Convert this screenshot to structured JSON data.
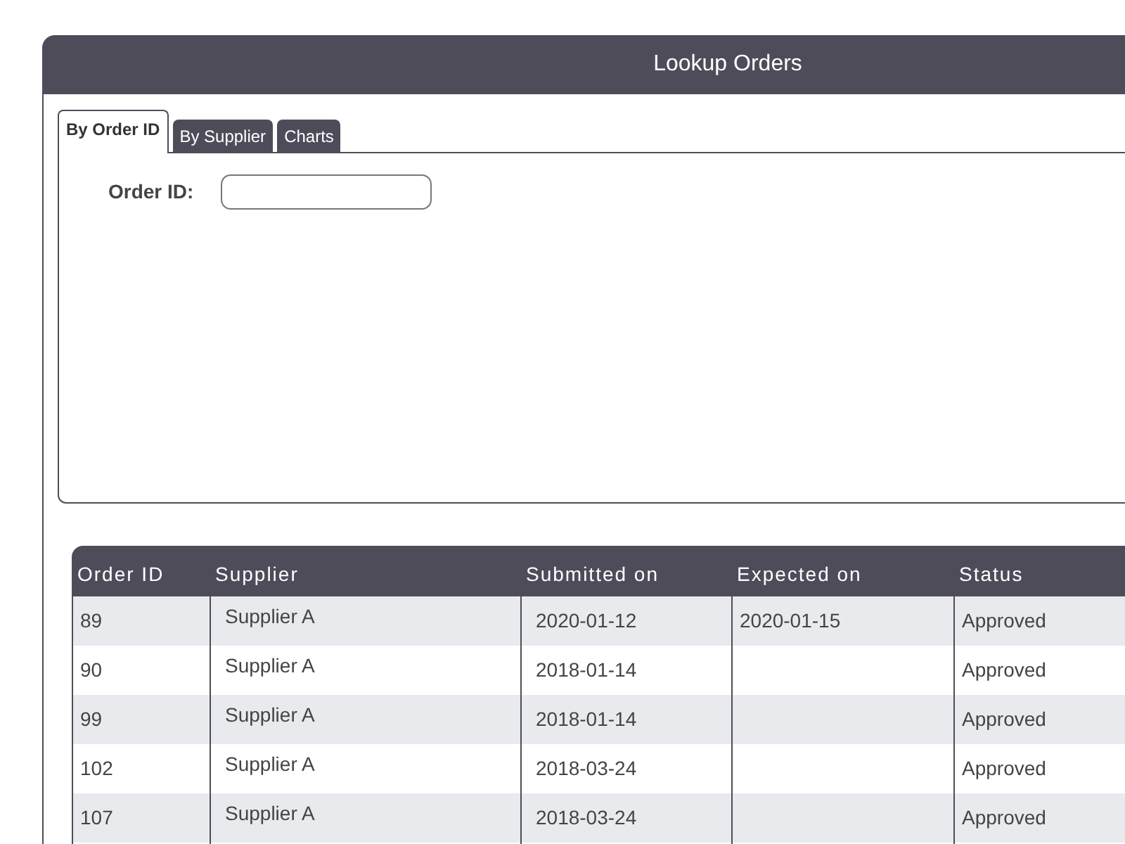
{
  "window": {
    "title": "Lookup Orders"
  },
  "tabs": [
    {
      "label": "By Order ID",
      "selected": true
    },
    {
      "label": "By Supplier",
      "selected": false
    },
    {
      "label": "Charts",
      "selected": false
    }
  ],
  "order_id_field": {
    "label": "Order ID:"
  },
  "table": {
    "columns": [
      "Order ID",
      "Supplier",
      "Submitted on",
      "Expected on",
      "Status"
    ],
    "rows": [
      {
        "order_id": "89",
        "supplier": "Supplier A",
        "submitted_on": "2020-01-12",
        "expected_on": "2020-01-15",
        "status": "Approved"
      },
      {
        "order_id": "90",
        "supplier": "Supplier A",
        "submitted_on": "2018-01-14",
        "status": "Approved"
      },
      {
        "order_id": "99",
        "supplier": "Supplier A",
        "submitted_on": "2018-01-14",
        "status": "Approved"
      },
      {
        "order_id": "102",
        "supplier": "Supplier A",
        "submitted_on": "2018-03-24",
        "status": "Approved"
      },
      {
        "order_id": "107",
        "supplier": "Supplier A",
        "submitted_on": "2018-03-24",
        "status": "Approved"
      }
    ]
  }
}
